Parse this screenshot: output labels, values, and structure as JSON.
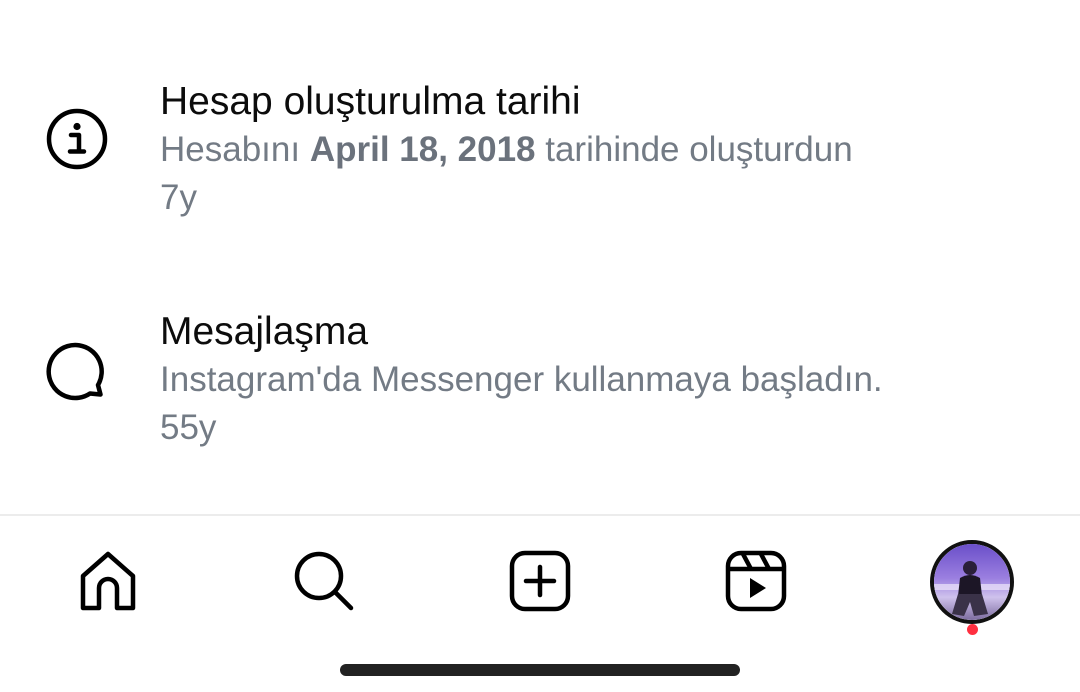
{
  "activities": [
    {
      "icon": "info-icon",
      "title": "Hesap oluşturulma tarihi",
      "desc_prefix": "Hesabını ",
      "desc_bold": "April 18, 2018",
      "desc_suffix": " tarihinde oluşturdun",
      "time": "7y"
    },
    {
      "icon": "message-bubble-icon",
      "title": "Mesajlaşma",
      "desc": "Instagram'da Messenger kullanmaya başladın.",
      "time": "55y"
    }
  ],
  "tab_bar": {
    "items": [
      "home-icon",
      "search-icon",
      "create-icon",
      "reels-icon",
      "profile-avatar"
    ],
    "notification_dot_color": "#ff2f40"
  }
}
